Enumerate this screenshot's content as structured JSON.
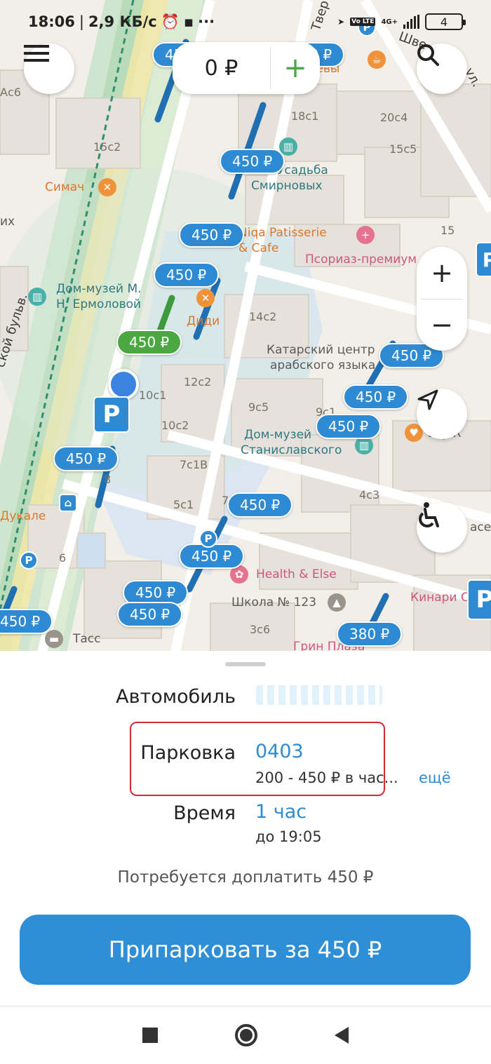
{
  "status": {
    "time": "18:06",
    "speed": "2,9 КБ/с",
    "network": "4G+",
    "volte": "Vo LTE",
    "battery": "4"
  },
  "balance": {
    "amount": "0 ₽",
    "add_label": "+"
  },
  "map": {
    "prices": [
      "450 ₽",
      "450 ₽",
      "450 ₽",
      "450 ₽",
      "450 ₽",
      "450 ₽",
      "450 ₽",
      "450 ₽",
      "450 ₽",
      "450 ₽",
      "450 ₽",
      "450 ₽",
      "450 ₽",
      "450 ₽",
      "450 ₽",
      "380 ₽"
    ],
    "selected_price": "450 ₽",
    "places": {
      "simach": "Симач",
      "usadba1": "Усадьба",
      "usadba2": "Смирновых",
      "niqa1": "Niqa Patisserie",
      "niqa2": "& Cafe",
      "psoriaz": "Псориаз-премиум",
      "dommuzei1_1": "Дом-музей М.",
      "dommuzei1_2": "Н. Ермоловой",
      "didi": "Диди",
      "katar1": "Катарский центр",
      "katar2": "арабского языка",
      "dommuzei2_1": "Дом-музей",
      "dommuzei2_2": "Станиславского",
      "health": "Health & Else",
      "school": "Школа № 123",
      "kinari": "Кинари С",
      "tass": "Тасс",
      "dukale": "Дукале",
      "grin": "Грин Плаза",
      "vaevy": "ваевы",
      "boulevard": "ской бульв.",
      "tver": "Твер",
      "shve": "Шве",
      "sky": "Sky R",
      "ace": "ace",
      "ikh": "их",
      "ul": "ул."
    },
    "houses": [
      "18с1",
      "20с4",
      "15с2",
      "15с5",
      "15",
      "14с2",
      "12с2",
      "10с1",
      "10с2",
      "9с5",
      "9с1",
      "7с1В",
      "5с1",
      "7",
      "4с3",
      "8",
      "6",
      "3с6",
      "Ас6"
    ]
  },
  "sheet": {
    "car_label": "Автомобиль",
    "parking_label": "Парковка",
    "parking_value": "0403",
    "parking_rate": "200 - 450 ₽ в час...",
    "parking_more": "ещё",
    "time_label": "Время",
    "time_value": "1 час",
    "time_until": "до 19:05",
    "need_pay": "Потребуется доплатить 450 ₽",
    "park_button": "Припарковать за 450 ₽"
  },
  "colors": {
    "accent": "#2e8bd3",
    "green": "#4aa742",
    "highlight": "#d6283a"
  },
  "icons": [
    "menu-icon",
    "search-icon",
    "plus-icon",
    "minus-icon",
    "locate-icon",
    "wheelchair-icon",
    "parking-icon",
    "museum-icon",
    "restaurant-icon",
    "cafe-icon",
    "pharmacy-icon",
    "wine-icon",
    "school-icon",
    "metro-icon",
    "nav-home-icon",
    "nav-back-icon",
    "nav-recents-icon"
  ]
}
